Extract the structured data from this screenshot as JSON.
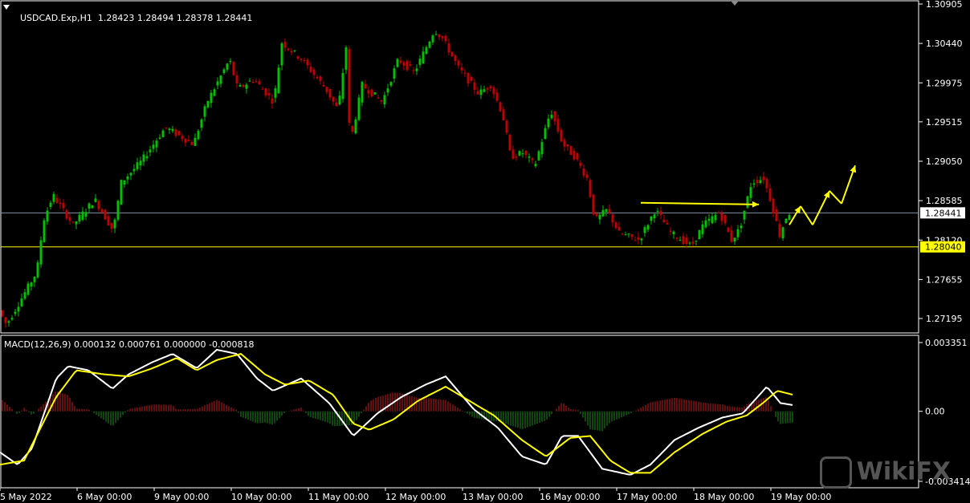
{
  "header": {
    "symbol": "USDCAD.Exp,H1",
    "ohlc": "1.28423 1.28494 1.28378 1.28441",
    "macd_label": "MACD(12,26,9) 0.000132 0.000761 0.000000 -0.000818"
  },
  "watermark": {
    "text": "WikiFX"
  },
  "chart_data": [
    {
      "type": "candlestick",
      "symbol": "USDCAD.Exp",
      "timeframe": "H1",
      "y_ticks": [
        "1.30905",
        "1.30440",
        "1.29975",
        "1.29515",
        "1.29050",
        "1.28585",
        "1.28120",
        "1.27655",
        "1.27195"
      ],
      "ylim": [
        1.27,
        1.3095
      ],
      "price_lines": [
        {
          "value": 1.28441,
          "label": "1.28441",
          "color": "#8090a8",
          "label_bg": "#ffffff"
        },
        {
          "value": 1.2804,
          "label": "1.28040",
          "color": "#ffff00",
          "label_bg": "#ffff00"
        }
      ],
      "x_tick_labels": [
        "5 May 2022",
        "6 May 00:00",
        "9 May 00:00",
        "10 May 00:00",
        "11 May 00:00",
        "12 May 00:00",
        "13 May 00:00",
        "16 May 00:00",
        "17 May 00:00",
        "18 May 00:00",
        "19 May 00:00"
      ],
      "colors": {
        "up": "#00c000",
        "down": "#c00000"
      },
      "anchors": [
        [
          0,
          1.2735
        ],
        [
          12,
          1.2712
        ],
        [
          50,
          1.2775
        ],
        [
          58,
          1.2835
        ],
        [
          70,
          1.2865
        ],
        [
          95,
          1.283
        ],
        [
          122,
          1.286
        ],
        [
          145,
          1.2823
        ],
        [
          155,
          1.288
        ],
        [
          180,
          1.2905
        ],
        [
          210,
          1.2945
        ],
        [
          245,
          1.2925
        ],
        [
          262,
          1.2975
        ],
        [
          290,
          1.3025
        ],
        [
          300,
          1.299
        ],
        [
          320,
          1.3002
        ],
        [
          345,
          1.2975
        ],
        [
          355,
          1.3045
        ],
        [
          380,
          1.3025
        ],
        [
          410,
          1.299
        ],
        [
          425,
          1.2965
        ],
        [
          435,
          1.304
        ],
        [
          440,
          1.2925
        ],
        [
          455,
          1.2995
        ],
        [
          480,
          1.2975
        ],
        [
          500,
          1.3025
        ],
        [
          520,
          1.301
        ],
        [
          545,
          1.306
        ],
        [
          555,
          1.305
        ],
        [
          575,
          1.3015
        ],
        [
          600,
          1.2985
        ],
        [
          615,
          1.2995
        ],
        [
          630,
          1.296
        ],
        [
          640,
          1.291
        ],
        [
          655,
          1.2915
        ],
        [
          670,
          1.29
        ],
        [
          690,
          1.2965
        ],
        [
          705,
          1.2925
        ],
        [
          720,
          1.291
        ],
        [
          735,
          1.2885
        ],
        [
          745,
          1.2835
        ],
        [
          760,
          1.2848
        ],
        [
          775,
          1.282
        ],
        [
          800,
          1.2812
        ],
        [
          820,
          1.2848
        ],
        [
          840,
          1.282
        ],
        [
          865,
          1.2805
        ],
        [
          880,
          1.283
        ],
        [
          900,
          1.2845
        ],
        [
          915,
          1.2812
        ],
        [
          925,
          1.2825
        ],
        [
          940,
          1.288
        ],
        [
          955,
          1.2885
        ],
        [
          965,
          1.2855
        ],
        [
          975,
          1.2818
        ],
        [
          985,
          1.2844
        ]
      ],
      "annotations": {
        "horizontal_arrow": [
          [
            798,
            1.2856
          ],
          [
            945,
            1.2854
          ]
        ],
        "zigzag_arrow": [
          [
            983,
            1.283
          ],
          [
            997,
            1.2852
          ],
          [
            1012,
            1.283
          ],
          [
            1033,
            1.287
          ],
          [
            1048,
            1.2855
          ],
          [
            1065,
            1.29
          ]
        ],
        "arrow_color": "#ffff00"
      }
    },
    {
      "type": "macd",
      "params": "MACD(12,26,9)",
      "values": {
        "main": 0.000132,
        "signal": 0.000761,
        "third": 0.0,
        "fourth": -0.000818
      },
      "y_ticks": [
        "0.003351",
        "0.00",
        "-0.003414"
      ],
      "ylim": [
        -0.003414,
        0.003351
      ],
      "series": [
        {
          "role": "macd",
          "color": "#ffffff",
          "anchors": [
            [
              0,
              -0.002
            ],
            [
              22,
              -0.0026
            ],
            [
              40,
              -0.0018
            ],
            [
              70,
              0.0016
            ],
            [
              85,
              0.0022
            ],
            [
              110,
              0.002
            ],
            [
              140,
              0.0011
            ],
            [
              160,
              0.0018
            ],
            [
              190,
              0.0024
            ],
            [
              215,
              0.0028
            ],
            [
              245,
              0.0021
            ],
            [
              270,
              0.003
            ],
            [
              295,
              0.0028
            ],
            [
              320,
              0.0016
            ],
            [
              340,
              0.001
            ],
            [
              375,
              0.0016
            ],
            [
              410,
              0.0004
            ],
            [
              440,
              -0.0012
            ],
            [
              470,
              -0.0001
            ],
            [
              500,
              0.0007
            ],
            [
              530,
              0.0013
            ],
            [
              555,
              0.0017
            ],
            [
              590,
              0.0001
            ],
            [
              620,
              -0.0008
            ],
            [
              650,
              -0.0022
            ],
            [
              680,
              -0.0026
            ],
            [
              700,
              -0.0012
            ],
            [
              720,
              -0.0012
            ],
            [
              750,
              -0.0028
            ],
            [
              785,
              -0.0031
            ],
            [
              810,
              -0.0026
            ],
            [
              840,
              -0.0014
            ],
            [
              870,
              -0.0008
            ],
            [
              900,
              -0.0003
            ],
            [
              925,
              -0.0001
            ],
            [
              955,
              0.0012
            ],
            [
              972,
              0.0004
            ],
            [
              988,
              0.0003
            ]
          ]
        },
        {
          "role": "signal",
          "color": "#ffff00",
          "anchors": [
            [
              0,
              -0.0026
            ],
            [
              30,
              -0.0024
            ],
            [
              70,
              0.0007
            ],
            [
              95,
              0.002
            ],
            [
              130,
              0.0018
            ],
            [
              160,
              0.0017
            ],
            [
              190,
              0.0021
            ],
            [
              220,
              0.0026
            ],
            [
              245,
              0.002
            ],
            [
              270,
              0.0025
            ],
            [
              300,
              0.0028
            ],
            [
              330,
              0.0018
            ],
            [
              355,
              0.0013
            ],
            [
              385,
              0.0015
            ],
            [
              415,
              0.0008
            ],
            [
              440,
              -0.0006
            ],
            [
              460,
              -0.0009
            ],
            [
              490,
              -0.0004
            ],
            [
              520,
              0.0005
            ],
            [
              555,
              0.0012
            ],
            [
              585,
              0.0005
            ],
            [
              615,
              -0.0002
            ],
            [
              650,
              -0.0014
            ],
            [
              680,
              -0.0022
            ],
            [
              710,
              -0.0013
            ],
            [
              735,
              -0.0012
            ],
            [
              760,
              -0.0024
            ],
            [
              785,
              -0.003
            ],
            [
              810,
              -0.003
            ],
            [
              840,
              -0.002
            ],
            [
              875,
              -0.0011
            ],
            [
              905,
              -0.0005
            ],
            [
              930,
              -0.0002
            ],
            [
              950,
              0.0004
            ],
            [
              968,
              0.001
            ],
            [
              988,
              0.0008
            ]
          ]
        }
      ]
    }
  ]
}
